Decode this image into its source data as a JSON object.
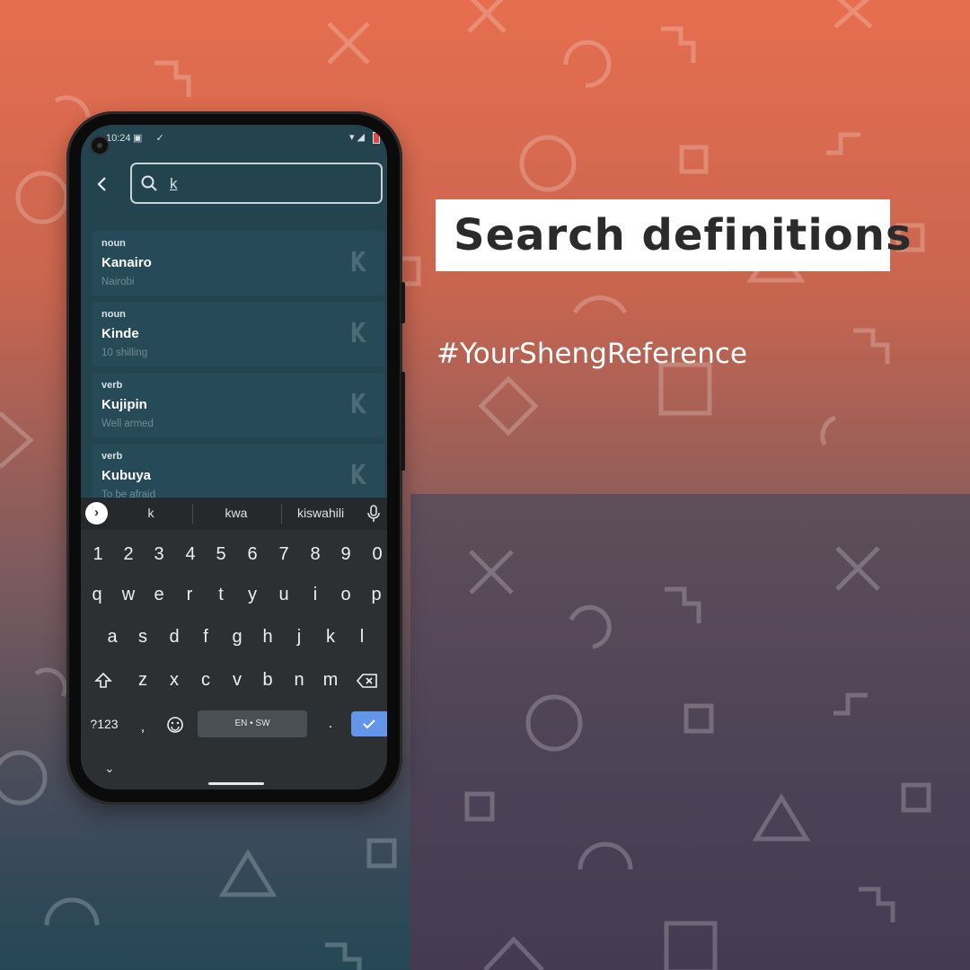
{
  "headline": "Search definitions",
  "hashtag": "#YourShengReference",
  "phone": {
    "status": {
      "time": "10:24",
      "icons_left": "▣ ✓",
      "icons_right": "▾◢"
    },
    "search": {
      "query": "k"
    },
    "results": [
      {
        "type": "noun",
        "word": "Kanairo",
        "definition": "Nairobi",
        "letter": "K"
      },
      {
        "type": "noun",
        "word": "Kinde",
        "definition": "10 shilling",
        "letter": "K"
      },
      {
        "type": "verb",
        "word": "Kujipin",
        "definition": "Well armed",
        "letter": "K"
      },
      {
        "type": "verb",
        "word": "Kubuya",
        "definition": "To be afraid",
        "letter": "K"
      }
    ],
    "keyboard": {
      "suggestions": [
        "k",
        "kwa",
        "kiswahili"
      ],
      "number_row": [
        "1",
        "2",
        "3",
        "4",
        "5",
        "6",
        "7",
        "8",
        "9",
        "0"
      ],
      "row1": [
        "q",
        "w",
        "e",
        "r",
        "t",
        "y",
        "u",
        "i",
        "o",
        "p"
      ],
      "row2": [
        "a",
        "s",
        "d",
        "f",
        "g",
        "h",
        "j",
        "k",
        "l"
      ],
      "row3": [
        "z",
        "x",
        "c",
        "v",
        "b",
        "n",
        "m"
      ],
      "symbols_label": "?123",
      "comma": ",",
      "period": ".",
      "space_label": "EN • SW"
    }
  },
  "colors": {
    "accent_enter": "#6396e8",
    "screen_bg": "#23434f",
    "card_bg": "#264a57"
  },
  "icons": [
    "back-arrow-icon",
    "search-icon",
    "suggestion-arrow-icon",
    "mic-icon",
    "shift-icon",
    "backspace-icon",
    "emoji-icon",
    "check-icon",
    "chevron-down-icon"
  ]
}
